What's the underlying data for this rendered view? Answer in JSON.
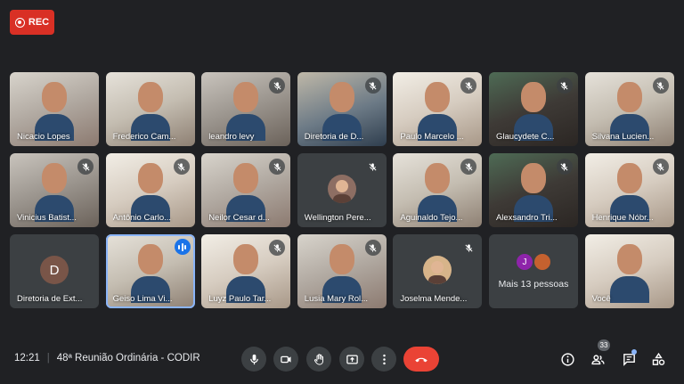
{
  "recording": {
    "label": "REC"
  },
  "participants": [
    {
      "name": "Nicacio Lopes",
      "muted": false,
      "kind": "video",
      "style": "v1"
    },
    {
      "name": "Frederico Cam...",
      "muted": false,
      "kind": "video",
      "style": "v4"
    },
    {
      "name": "leandro levy",
      "muted": true,
      "kind": "video",
      "style": "v2"
    },
    {
      "name": "Diretoria de D...",
      "muted": true,
      "kind": "video",
      "style": "v3"
    },
    {
      "name": "Paulo Marcelo ...",
      "muted": true,
      "kind": "video",
      "style": "v6"
    },
    {
      "name": "Glaucydete C...",
      "muted": true,
      "kind": "video",
      "style": "v5"
    },
    {
      "name": "Silvana Lucien...",
      "muted": true,
      "kind": "video",
      "style": "v4"
    },
    {
      "name": "Vinicius Batist...",
      "muted": true,
      "kind": "video",
      "style": "v2"
    },
    {
      "name": "Antônio Carlo...",
      "muted": true,
      "kind": "video",
      "style": "v6"
    },
    {
      "name": "Neilor Cesar d...",
      "muted": true,
      "kind": "video",
      "style": "v1"
    },
    {
      "name": "Wellington Pere...",
      "muted": true,
      "kind": "photo",
      "avatar_color": "#8d6e63"
    },
    {
      "name": "Aguinaldo Tejo...",
      "muted": true,
      "kind": "video",
      "style": "v4"
    },
    {
      "name": "Alexsandro Tri...",
      "muted": true,
      "kind": "video",
      "style": "v5"
    },
    {
      "name": "Henrique Nóbr...",
      "muted": true,
      "kind": "video",
      "style": "v6"
    },
    {
      "name": "Diretoria de Ext...",
      "muted": false,
      "kind": "letter",
      "avatar_letter": "D",
      "avatar_color": "#795548"
    },
    {
      "name": "Geiso Lima Vi...",
      "muted": false,
      "kind": "video",
      "style": "v4",
      "speaking": true
    },
    {
      "name": "Luyz Paulo Tar...",
      "muted": true,
      "kind": "video",
      "style": "v6"
    },
    {
      "name": "Lusia Mary Rol...",
      "muted": true,
      "kind": "video",
      "style": "v1"
    },
    {
      "name": "Joselma Mende...",
      "muted": true,
      "kind": "photo",
      "avatar_color": "#d7b48a"
    },
    {
      "name": "",
      "muted": false,
      "kind": "more",
      "more_label": "Mais 13 pessoas",
      "more_letter": "J",
      "more_colors": [
        "#8e24aa",
        "#c5612f"
      ]
    },
    {
      "name": "Você",
      "muted": false,
      "kind": "video",
      "style": "v6"
    }
  ],
  "meeting": {
    "time": "12:21",
    "title": "48ª Reunião Ordinária - CODIR"
  },
  "controls": {
    "icons": [
      "mic-icon",
      "camera-icon",
      "raise-hand-icon",
      "present-screen-icon",
      "more-options-icon",
      "hang-up-icon"
    ],
    "hangup_color": "#ea4335"
  },
  "side_controls": {
    "participant_count": "33"
  }
}
